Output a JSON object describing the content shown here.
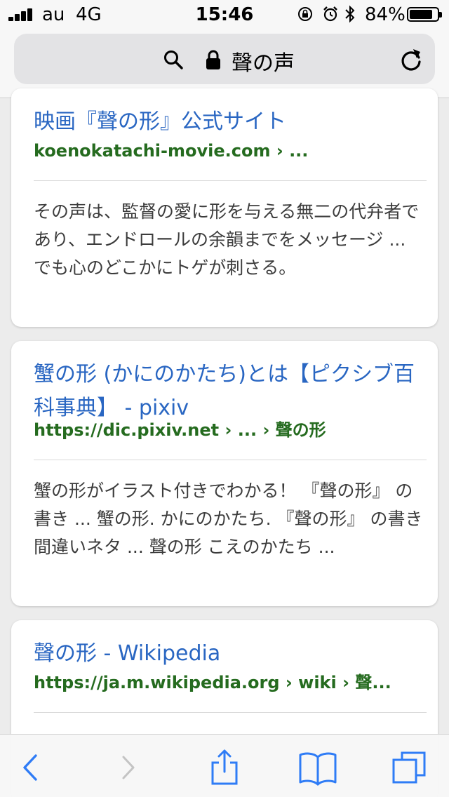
{
  "status_bar": {
    "carrier": "au",
    "network": "4G",
    "time": "15:46",
    "battery_percent": "84%",
    "battery_level": 0.84
  },
  "browser": {
    "address_text": "聲の声"
  },
  "results": [
    {
      "title": "映画『聲の形』公式サイト",
      "url": "koenokatachi-movie.com › ...",
      "snippet": "その声は、監督の愛に形を与える無二の代弁者であり、エンドロールの余韻までをメッセージ ... でも心のどこかにトゲが刺さる。"
    },
    {
      "title": "蟹の形 (かにのかたち)とは【ピクシブ百科事典】 - pixiv",
      "url": "https://dic.pixiv.net › ... › 聲の形",
      "snippet": "蟹の形がイラスト付きでわかる！ 『聲の形』 の書き ... 蟹の形. かにのかたち. 『聲の形』 の書き間違いネタ ... 聲の形 こえのかたち ..."
    },
    {
      "title": "聲の形 - Wikipedia",
      "url": "https://ja.m.wikipedia.org › wiki › 聲...",
      "snippet": ""
    }
  ],
  "colors": {
    "link": "#2966c2",
    "url": "#256b1f",
    "toolbar_tint": "#2f7cf6"
  }
}
